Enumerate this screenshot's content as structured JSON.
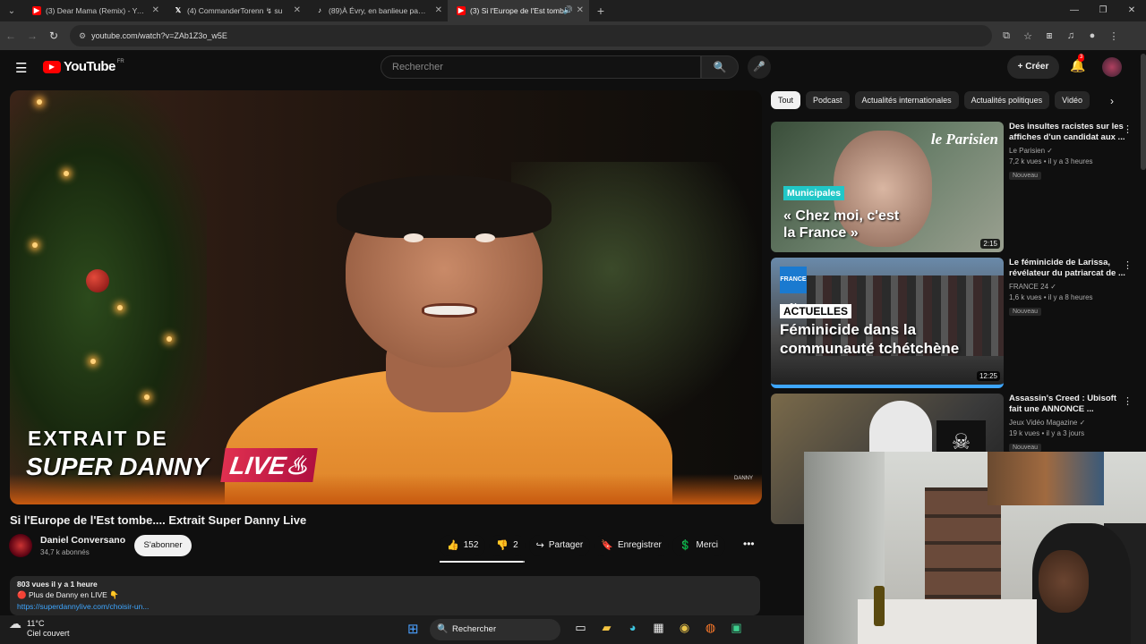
{
  "browser": {
    "tabs": [
      {
        "title": "(3) Dear Mama (Remix) - YouTu",
        "favicon": "youtube-icon",
        "active": false
      },
      {
        "title": "(4) CommanderTorenn ↯ su",
        "favicon": "x-icon",
        "active": false
      },
      {
        "title": "(89)À Évry, en banlieue parisier",
        "favicon": "tiktok-icon",
        "active": false
      },
      {
        "title": "(3) Si l'Europe de l'Est tomb",
        "favicon": "youtube-icon",
        "active": true
      }
    ],
    "url": "youtube.com/watch?v=ZAb1Z3o_w5E"
  },
  "youtube": {
    "logo_text": "YouTube",
    "region": "FR",
    "search_placeholder": "Rechercher",
    "create_label": "Créer",
    "notifications_count": "3"
  },
  "video": {
    "overlay_line1": "EXTRAIT DE",
    "overlay_line2": "SUPER DANNY",
    "overlay_live": "LIVE",
    "watermark": "DANNY",
    "title": "Si l'Europe de l'Est tombe.... Extrait Super Danny Live",
    "channel": "Daniel Conversano",
    "subscribers": "34,7 k abonnés",
    "subscribe_label": "S'abonner",
    "likes": "152",
    "dislikes": "2",
    "share_label": "Partager",
    "save_label": "Enregistrer",
    "thanks_label": "Merci",
    "views_time": "803 vues  il y a 1 heure",
    "desc_line1": "🔴 Plus de Danny en LIVE 👇",
    "desc_link": "https://superdannylive.com/choisir-un..."
  },
  "chips": [
    "Tout",
    "Podcast",
    "Actualités internationales",
    "Actualités politiques",
    "Vidéo"
  ],
  "recommendations": [
    {
      "title": "Des insultes racistes sur les affiches d'un candidat aux ...",
      "channel": "Le Parisien",
      "meta": "7,2 k vues • il y a 3 heures",
      "badge": "Nouveau",
      "duration": "2:15",
      "thumb_brand": "le Parisien",
      "thumb_tag": "Municipales",
      "thumb_text": "« Chez moi, c'est la France »"
    },
    {
      "title": "Le féminicide de Larissa, révélateur du patriarcat de ...",
      "channel": "FRANCE 24",
      "meta": "1,6 k vues • il y a 8 heures",
      "badge": "Nouveau",
      "duration": "12:25",
      "thumb_brand": "FRANCE 24",
      "thumb_tag": "ACTUELLES",
      "thumb_text": "Féminicide dans la communauté tchétchène"
    },
    {
      "title": "Assassin's Creed : Ubisoft fait une ANNONCE ...",
      "channel": "Jeux Vidéo Magazine",
      "meta": "19 k vues • il y a 3 jours",
      "badge": "Nouveau",
      "duration": "",
      "thumb_brand": "",
      "thumb_tag": "",
      "thumb_text": ""
    }
  ],
  "taskbar": {
    "temp": "11°C",
    "weather": "Ciel couvert",
    "search_placeholder": "Rechercher"
  }
}
